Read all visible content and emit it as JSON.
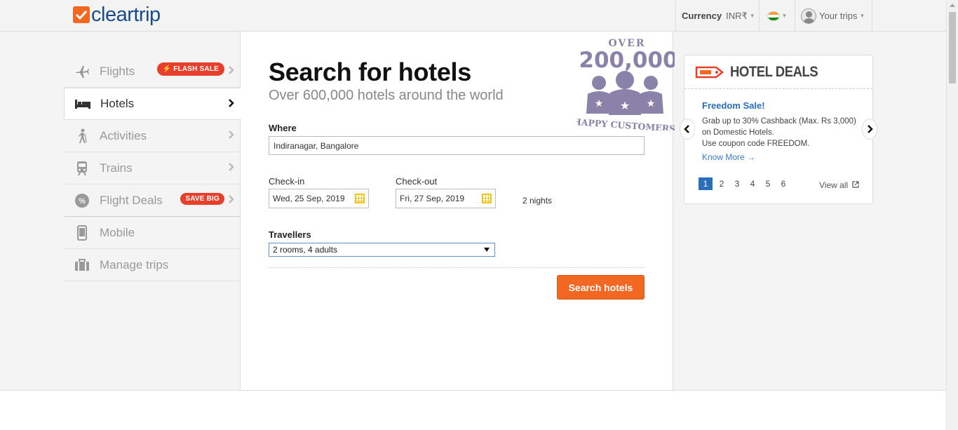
{
  "header": {
    "logo_text": "cleartrip",
    "currency_label": "Currency",
    "currency_value": "INR₹",
    "your_trips": "Your trips"
  },
  "sidebar": {
    "items": [
      {
        "label": "Flights",
        "badge": "FLASH SALE"
      },
      {
        "label": "Hotels"
      },
      {
        "label": "Activities"
      },
      {
        "label": "Trains"
      },
      {
        "label": "Flight Deals",
        "badge": "SAVE BIG"
      },
      {
        "label": "Mobile"
      },
      {
        "label": "Manage trips"
      }
    ]
  },
  "main": {
    "title": "Search for hotels",
    "subtitle": "Over 600,000 hotels around the world",
    "where_label": "Where",
    "where_value": "Indiranagar, Bangalore",
    "checkin_label": "Check-in",
    "checkin_value": "Wed, 25 Sep, 2019",
    "checkout_label": "Check-out",
    "checkout_value": "Fri, 27 Sep, 2019",
    "nights": "2 nights",
    "travellers_label": "Travellers",
    "travellers_value": "2 rooms, 4 adults",
    "search_button": "Search hotels"
  },
  "stamp": {
    "over": "OVER",
    "count": "200,000",
    "caption": "HAPPY CUSTOMERS"
  },
  "deals": {
    "title": "HOTEL DEALS",
    "deal_name": "Freedom Sale!",
    "deal_desc": "Grab up to 30% Cashback (Max. Rs 3,000) on Domestic Hotels.",
    "deal_code": "Use coupon code FREEDOM.",
    "know_more": "Know More →",
    "pages": [
      "1",
      "2",
      "3",
      "4",
      "5",
      "6"
    ],
    "current_page": "1",
    "view_all": "View all"
  },
  "colors": {
    "brand_orange": "#f26722",
    "brand_blue": "#1a4c8b",
    "link_blue": "#2a6ebb",
    "badge_red": "#e6402c"
  }
}
